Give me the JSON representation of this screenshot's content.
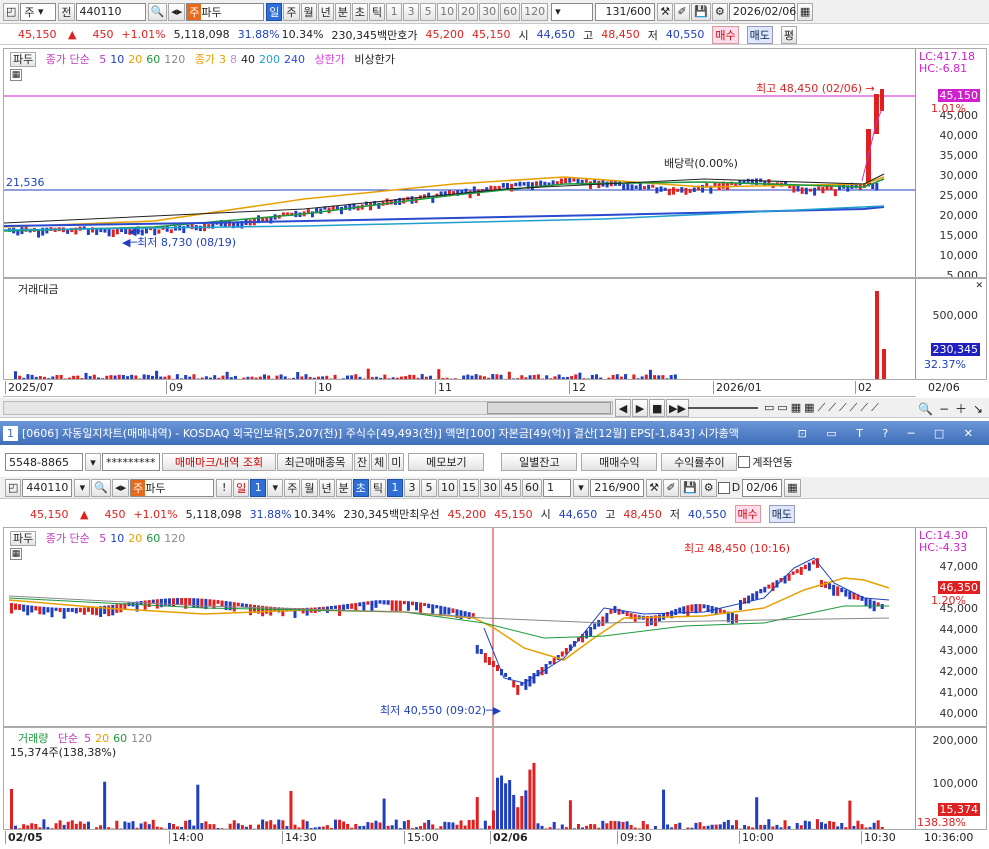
{
  "top": {
    "toolbar": {
      "stock_type": "주",
      "period_btn": "전",
      "code": "440110",
      "market_badge": "주",
      "name": "파두",
      "periods": [
        "일",
        "주",
        "월",
        "년",
        "분",
        "초",
        "틱"
      ],
      "minutes": [
        "1",
        "3",
        "5",
        "10",
        "20",
        "30",
        "60",
        "120"
      ],
      "count": "131",
      "count_total": "/600",
      "date": "2026/02/06"
    },
    "quote": {
      "price": "45,150",
      "arrow": "▲",
      "change": "450",
      "rate": "+1.01%",
      "volume": "5,118,098",
      "turnover": "31.88%",
      "ratio": "10.34%",
      "amount": "230,345백만",
      "ask_label": "호가",
      "ask": "45,200",
      "bid": "45,150",
      "open_label": "시",
      "open": "44,650",
      "high_label": "고",
      "high": "48,450",
      "low_label": "저",
      "low": "40,550",
      "buy": "매수",
      "sell": "매도",
      "extra": "평"
    },
    "legend": {
      "name": "파두",
      "ma_label": "종가 단순",
      "ma": [
        "5",
        "10",
        "20",
        "60",
        "120"
      ],
      "ma2_label": "종가",
      "ma2": [
        "3",
        "8",
        "40",
        "200",
        "240"
      ],
      "upper": "상한가",
      "nonupper": "비상한가"
    },
    "axis": {
      "lc": "LC:417.18",
      "hc": "HC:-6.81",
      "price_tag": "45,150",
      "pct_tag": "1.01%",
      "ticks": [
        "45,000",
        "40,000",
        "35,000",
        "30,000",
        "25,000",
        "20,000",
        "15,000",
        "10,000",
        "5,000"
      ],
      "hline_label": "21,536"
    },
    "notes": {
      "high": "최고 48,450 (02/06)",
      "low": "최저 8,730 (08/19)",
      "dividend": "배당락(0.00%)"
    },
    "vol": {
      "label": "거래대금",
      "ticks": [
        "500,000"
      ],
      "tag": "230,345",
      "pct": "32.37%"
    },
    "xaxis": [
      "2025/07",
      "09",
      "10",
      "11",
      "12",
      "2026/01",
      "02",
      "02/06"
    ]
  },
  "win": {
    "title": "[0606] 자동일지차트(매매내역) - KOSDAQ 외국인보유[5,207(천)] 주식수[49,493(천)] 액면[100] 자본금[49(억)] 결산[12월] EPS[-1,843] 시가총액",
    "num": "1"
  },
  "acct": {
    "account": "5548-8865",
    "password": "*********",
    "mark_btn": "매매마크/내역 조회",
    "recent": "최근매매종목",
    "j": "잔",
    "c": "체",
    "m": "미",
    "memo": "메모보기",
    "daily": "일별잔고",
    "profit": "매매수익",
    "trend": "수익률추이",
    "link": "계좌연동"
  },
  "bottom": {
    "toolbar": {
      "code": "440110",
      "market_badge": "주",
      "name": "파두",
      "excl": "!",
      "period": "일",
      "period_val": "1",
      "periods": [
        "주",
        "월",
        "년",
        "분",
        "초",
        "틱"
      ],
      "minutes": [
        "1",
        "3",
        "5",
        "10",
        "15",
        "30",
        "45",
        "60"
      ],
      "step": "1",
      "count": "216",
      "count_total": "/900",
      "d_label": "D",
      "date": "02/06"
    },
    "quote": {
      "price": "45,150",
      "arrow": "▲",
      "change": "450",
      "rate": "+1.01%",
      "volume": "5,118,098",
      "turnover": "31.88%",
      "ratio": "10.34%",
      "amount": "230,345백만",
      "ask_label": "최우선",
      "ask": "45,200",
      "bid": "45,150",
      "open_label": "시",
      "open": "44,650",
      "high_label": "고",
      "high": "48,450",
      "low_label": "저",
      "low": "40,550",
      "buy": "매수",
      "sell": "매도"
    },
    "legend": {
      "name": "파두",
      "ma_label": "종가 단순",
      "ma": [
        "5",
        "10",
        "20",
        "60",
        "120"
      ]
    },
    "axis": {
      "lc": "LC:14.30",
      "hc": "HC:-4.33",
      "price_tag": "46,350",
      "pct_tag": "1.20%",
      "ticks": [
        "47,000",
        "45,000",
        "44,000",
        "43,000",
        "42,000",
        "41,000",
        "40,000"
      ]
    },
    "notes": {
      "high": "최고 48,450 (10:16)",
      "low": "최저 40,550 (09:02)"
    },
    "vol": {
      "label": "거래량",
      "ma_label": "단순",
      "ma": [
        "5",
        "20",
        "60",
        "120"
      ],
      "sub": "15,374주(138,38%)",
      "ticks": [
        "200,000",
        "100,000"
      ],
      "tag": "15,374",
      "pct": "138.38%"
    },
    "xaxis": [
      "02/05",
      "14:00",
      "14:30",
      "15:00",
      "02/06",
      "09:30",
      "10:00",
      "10:30",
      "10:36:00"
    ]
  },
  "colors": {
    "up": "#e02020",
    "down": "#1f3fbf",
    "ma5": "#c03ac0",
    "ma20": "#e8a000",
    "ma60": "#1a9a3a",
    "hline": "#d020d0"
  }
}
